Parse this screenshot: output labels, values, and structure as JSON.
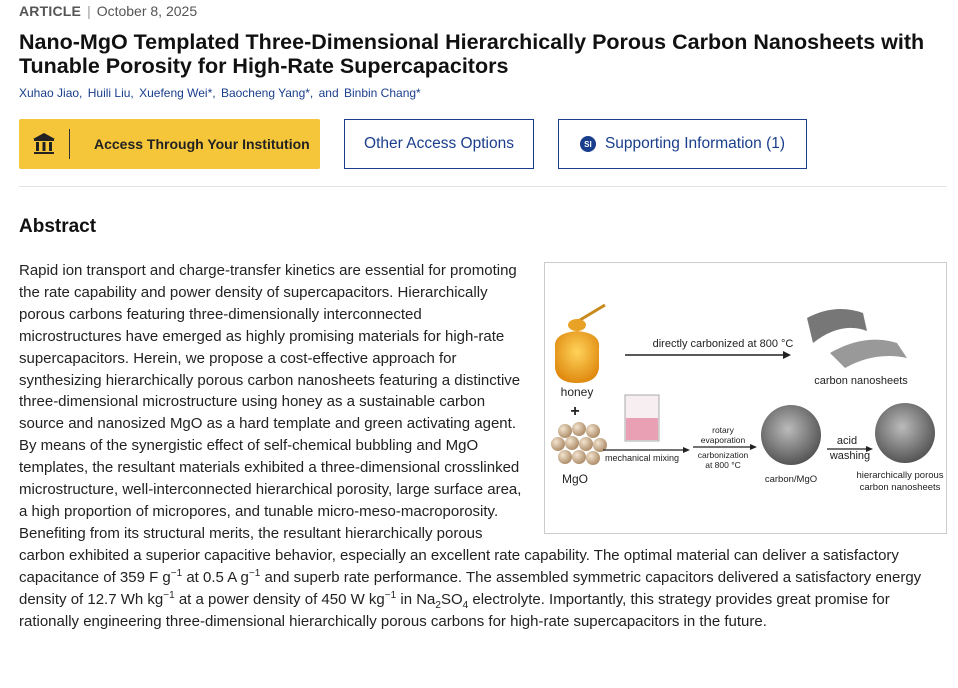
{
  "meta": {
    "type": "ARTICLE",
    "separator": "|",
    "date": "October 8, 2025"
  },
  "title": "Nano-MgO Templated Three-Dimensional Hierarchically Porous Carbon Nanosheets with Tunable Porosity for High-Rate Supercapacitors",
  "authors": [
    "Xuhao Jiao,",
    "Huili Liu,",
    "Xuefeng Wei*,",
    "Baocheng Yang*,",
    "and",
    "Binbin Chang*"
  ],
  "buttons": {
    "institution": "Access Through Your Institution",
    "other": "Other Access Options",
    "si_badge": "SI",
    "supporting": "Supporting Information (1)"
  },
  "abstract": {
    "heading": "Abstract",
    "p1": "Rapid ion transport and charge-transfer kinetics are essential for promoting the rate capability and power density of supercapacitors. Hierarchically porous carbons featuring three-dimensionally interconnected microstructures have emerged as highly promising materials for high-rate supercapacitors. Herein, we propose a cost-effective approach for synthesizing hierarchically porous carbon nanosheets featuring a distinctive three-dimensional microstructure using honey as a sustainable carbon source and nanosized MgO as a hard template and green activating agent. By means of the synergistic effect of self-chemical bubbling and MgO templates, the resultant materials exhibited a three-dimensional crosslinked microstructure, well-interconnected hierarchical porosity, large surface area, a high proportion of micropores, and tunable micro-meso-macroporosity. Benefiting from its structural merits, the resultant hierarchically porous carbon exhibited a superior capacitive behavior, especially an excellent rate capability. The optimal material can deliver a satisfactory capacitance of 359 F g",
    "sup1": "−1",
    "p2": " at 0.5 A g",
    "sup2": "−1",
    "p3": " and superb rate performance. The assembled symmetric capacitors delivered a satisfactory energy density of 12.7 Wh kg",
    "sup3": "−1",
    "p4": " at a power density of 450 W kg",
    "sup4": "−1",
    "p5": " in Na",
    "sub1": "2",
    "p6": "SO",
    "sub2": "4",
    "p7": " electrolyte. Importantly, this strategy provides great promise for rationally engineering three-dimensional hierarchically porous carbons for high-rate supercapacitors in the future."
  },
  "toc": {
    "arrow1": "directly carbonized at 800 °C",
    "honey": "honey",
    "plus": "+",
    "mgo": "MgO",
    "carbon_nanosheets": "carbon nanosheets",
    "mixing": "mechanical mixing",
    "rotary1": "rotary",
    "rotary2": "evaporation",
    "carb1": "carbonization",
    "carb2": "at 800 °C",
    "carbon_mgo": "carbon/MgO",
    "acid": "acid",
    "washing": "washing",
    "hpc1": "hierarchically porous",
    "hpc2": "carbon nanosheets"
  },
  "colors": {
    "accent": "#1a3e8c",
    "button_yellow": "#f5c53a"
  }
}
